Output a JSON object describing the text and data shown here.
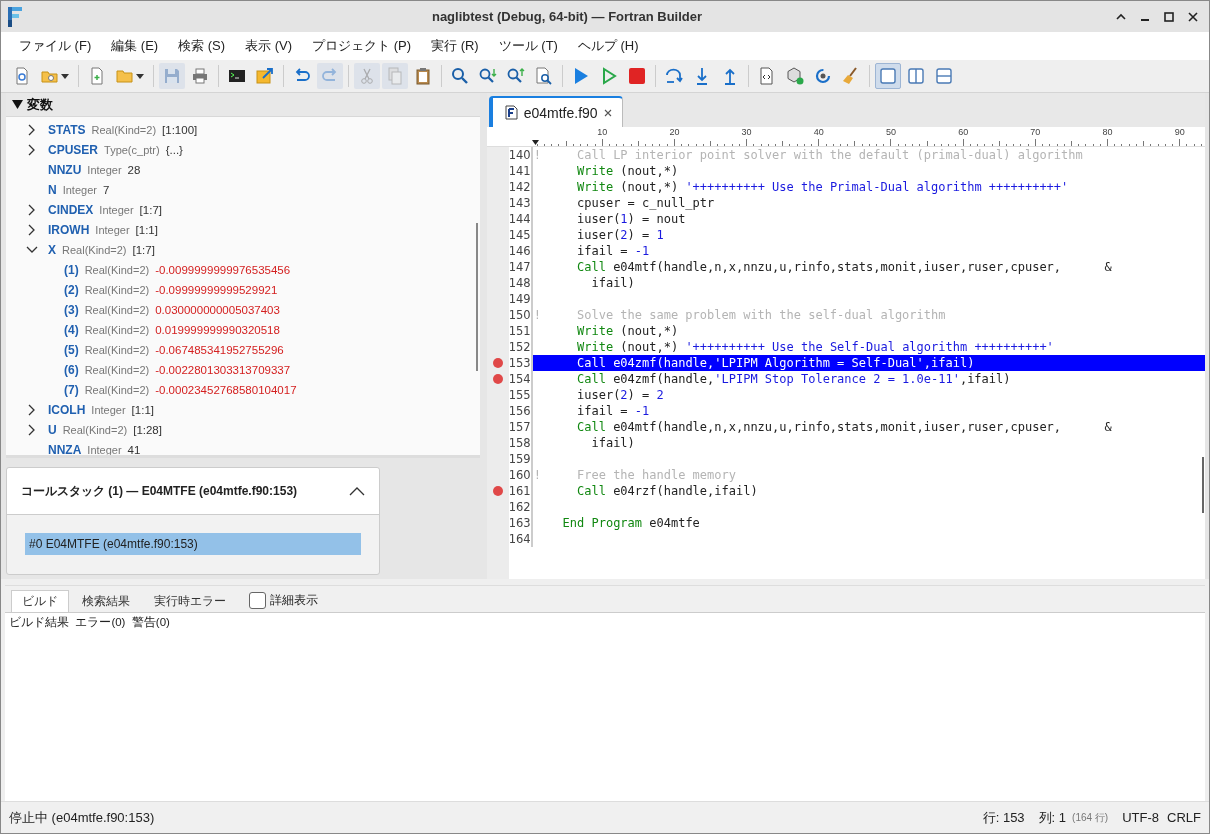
{
  "window": {
    "title": "naglibtest (Debug, 64-bit) — Fortran Builder"
  },
  "menu": [
    "ファイル (F)",
    "編集 (E)",
    "検索 (S)",
    "表示 (V)",
    "プロジェクト (P)",
    "実行 (R)",
    "ツール (T)",
    "ヘルプ (H)"
  ],
  "toolbar": [
    [
      {
        "kind": "project-settings",
        "disabled": false
      },
      {
        "kind": "open-project",
        "disabled": false,
        "dropdown": true
      }
    ],
    [
      {
        "kind": "new-file",
        "disabled": false
      },
      {
        "kind": "open-file",
        "disabled": false,
        "dropdown": true
      }
    ],
    [
      {
        "kind": "save",
        "disabled": true
      },
      {
        "kind": "print",
        "disabled": false
      }
    ],
    [
      {
        "kind": "terminal",
        "disabled": false
      },
      {
        "kind": "export",
        "disabled": false
      }
    ],
    [
      {
        "kind": "undo",
        "disabled": false
      },
      {
        "kind": "redo",
        "disabled": true
      }
    ],
    [
      {
        "kind": "cut",
        "disabled": true
      },
      {
        "kind": "copy",
        "disabled": true
      },
      {
        "kind": "paste",
        "disabled": false
      }
    ],
    [
      {
        "kind": "find",
        "disabled": false
      },
      {
        "kind": "find-next",
        "disabled": false
      },
      {
        "kind": "find-previous",
        "disabled": false
      },
      {
        "kind": "find-in-files",
        "disabled": false
      }
    ],
    [
      {
        "kind": "run",
        "disabled": false
      },
      {
        "kind": "run-without-debug",
        "disabled": false
      },
      {
        "kind": "stop",
        "disabled": false
      }
    ],
    [
      {
        "kind": "step-over",
        "disabled": false
      },
      {
        "kind": "step-into",
        "disabled": false
      },
      {
        "kind": "step-out",
        "disabled": false
      }
    ],
    [
      {
        "kind": "source-view",
        "disabled": false
      },
      {
        "kind": "add-module",
        "disabled": false
      },
      {
        "kind": "rebuild",
        "disabled": false
      },
      {
        "kind": "clean",
        "disabled": false
      }
    ],
    [
      {
        "kind": "layout-single",
        "disabled": false,
        "selected": true
      },
      {
        "kind": "layout-columns",
        "disabled": false,
        "selected": false
      },
      {
        "kind": "layout-rows",
        "disabled": false,
        "selected": false
      }
    ]
  ],
  "variables": {
    "title": "変数",
    "expanded": true,
    "items": [
      {
        "name": "STATS",
        "type": "Real(Kind=2)",
        "value": "[1:100]",
        "expanded": false,
        "changed": false
      },
      {
        "name": "CPUSER",
        "type": "Type(c_ptr)",
        "value": "{...}",
        "expanded": false,
        "changed": false
      },
      {
        "name": "NNZU",
        "type": "Integer",
        "value": "28",
        "changed": false
      },
      {
        "name": "N",
        "type": "Integer",
        "value": "7",
        "changed": false
      },
      {
        "name": "CINDEX",
        "type": "Integer",
        "value": "[1:7]",
        "expanded": false,
        "changed": false
      },
      {
        "name": "IROWH",
        "type": "Integer",
        "value": "[1:1]",
        "expanded": false,
        "changed": false
      },
      {
        "name": "X",
        "type": "Real(Kind=2)",
        "value": "[1:7]",
        "expanded": true,
        "changed": false,
        "children": [
          {
            "name": "(1)",
            "type": "Real(Kind=2)",
            "value": "-0.0099999999976535456",
            "changed": true
          },
          {
            "name": "(2)",
            "type": "Real(Kind=2)",
            "value": "-0.09999999999529921",
            "changed": true
          },
          {
            "name": "(3)",
            "type": "Real(Kind=2)",
            "value": "0.030000000005037403",
            "changed": true
          },
          {
            "name": "(4)",
            "type": "Real(Kind=2)",
            "value": "0.019999999990320518",
            "changed": true
          },
          {
            "name": "(5)",
            "type": "Real(Kind=2)",
            "value": "-0.067485341952755296",
            "changed": true
          },
          {
            "name": "(6)",
            "type": "Real(Kind=2)",
            "value": "-0.0022801303313709337",
            "changed": true
          },
          {
            "name": "(7)",
            "type": "Real(Kind=2)",
            "value": "-0.00023452768580104017",
            "changed": true
          }
        ]
      },
      {
        "name": "ICOLH",
        "type": "Integer",
        "value": "[1:1]",
        "expanded": false,
        "changed": false
      },
      {
        "name": "U",
        "type": "Real(Kind=2)",
        "value": "[1:28]",
        "expanded": false,
        "changed": false
      },
      {
        "name": "NNZA",
        "type": "Integer",
        "value": "41",
        "changed": false
      }
    ]
  },
  "call_stack": {
    "title": "コールスタック (1) — E04MTFE (e04mtfe.f90:153)",
    "expanded": true,
    "frames": [
      {
        "text": "#0  E04MTFE  (e04mtfe.f90:153)",
        "selected": true
      }
    ]
  },
  "editor": {
    "tabs": [
      {
        "label": "e04mtfe.f90",
        "selected": true
      }
    ],
    "ruler": [
      "10",
      "20",
      "30",
      "40",
      "50",
      "60",
      "70",
      "80",
      "90"
    ],
    "lines": [
      {
        "number": "140",
        "breakpoint": false,
        "current": false,
        "segments": [
          {
            "kind": "comment",
            "text": "!     Call LP interior point solver with the default (primal-dual) algorithm"
          }
        ]
      },
      {
        "number": "141",
        "breakpoint": false,
        "current": false,
        "segments": [
          {
            "kind": "keyword",
            "text": "      Write"
          },
          {
            "kind": "plain",
            "text": " (nout,*)"
          }
        ]
      },
      {
        "number": "142",
        "breakpoint": false,
        "current": false,
        "segments": [
          {
            "kind": "keyword",
            "text": "      Write"
          },
          {
            "kind": "plain",
            "text": " (nout,*) "
          },
          {
            "kind": "string",
            "text": "'++++++++++ Use the Primal-Dual algorithm ++++++++++'"
          }
        ]
      },
      {
        "number": "143",
        "breakpoint": false,
        "current": false,
        "segments": [
          {
            "kind": "plain",
            "text": "      cpuser = c_null_ptr"
          }
        ]
      },
      {
        "number": "144",
        "breakpoint": false,
        "current": false,
        "segments": [
          {
            "kind": "plain",
            "text": "      iuser("
          },
          {
            "kind": "number",
            "text": "1"
          },
          {
            "kind": "plain",
            "text": ") = nout"
          }
        ]
      },
      {
        "number": "145",
        "breakpoint": false,
        "current": false,
        "segments": [
          {
            "kind": "plain",
            "text": "      iuser("
          },
          {
            "kind": "number",
            "text": "2"
          },
          {
            "kind": "plain",
            "text": ") = "
          },
          {
            "kind": "number",
            "text": "1"
          }
        ]
      },
      {
        "number": "146",
        "breakpoint": false,
        "current": false,
        "segments": [
          {
            "kind": "plain",
            "text": "      ifail = "
          },
          {
            "kind": "number",
            "text": "-1"
          }
        ]
      },
      {
        "number": "147",
        "breakpoint": false,
        "current": false,
        "segments": [
          {
            "kind": "keyword",
            "text": "      Call"
          },
          {
            "kind": "plain",
            "text": " e04mtf(handle,n,x,nnzu,u,rinfo,stats,monit,iuser,ruser,cpuser,      &"
          }
        ]
      },
      {
        "number": "148",
        "breakpoint": false,
        "current": false,
        "segments": [
          {
            "kind": "plain",
            "text": "        ifail)"
          }
        ]
      },
      {
        "number": "149",
        "breakpoint": false,
        "current": false
      },
      {
        "number": "150",
        "breakpoint": false,
        "current": false,
        "segments": [
          {
            "kind": "comment",
            "text": "!     Solve the same problem with the self-dual algorithm"
          }
        ]
      },
      {
        "number": "151",
        "breakpoint": false,
        "current": false,
        "segments": [
          {
            "kind": "keyword",
            "text": "      Write"
          },
          {
            "kind": "plain",
            "text": " (nout,*)"
          }
        ]
      },
      {
        "number": "152",
        "breakpoint": false,
        "current": false,
        "segments": [
          {
            "kind": "keyword",
            "text": "      Write"
          },
          {
            "kind": "plain",
            "text": " (nout,*) "
          },
          {
            "kind": "string",
            "text": "'++++++++++ Use the Self-Dual algorithm ++++++++++'"
          }
        ]
      },
      {
        "number": "153",
        "breakpoint": true,
        "current": true,
        "segments": [
          {
            "kind": "keyword",
            "text": "      Call"
          },
          {
            "kind": "plain",
            "text": " e04zmf(handle,"
          },
          {
            "kind": "string",
            "text": "'LPIPM Algorithm = Self-Dual'"
          },
          {
            "kind": "plain",
            "text": ",ifail)"
          }
        ]
      },
      {
        "number": "154",
        "breakpoint": true,
        "current": false,
        "segments": [
          {
            "kind": "keyword",
            "text": "      Call"
          },
          {
            "kind": "plain",
            "text": " e04zmf(handle,"
          },
          {
            "kind": "string",
            "text": "'LPIPM Stop Tolerance 2 = 1.0e-11'"
          },
          {
            "kind": "plain",
            "text": ",ifail)"
          }
        ]
      },
      {
        "number": "155",
        "breakpoint": false,
        "current": false,
        "segments": [
          {
            "kind": "plain",
            "text": "      iuser("
          },
          {
            "kind": "number",
            "text": "2"
          },
          {
            "kind": "plain",
            "text": ") = "
          },
          {
            "kind": "number",
            "text": "2"
          }
        ]
      },
      {
        "number": "156",
        "breakpoint": false,
        "current": false,
        "segments": [
          {
            "kind": "plain",
            "text": "      ifail = "
          },
          {
            "kind": "number",
            "text": "-1"
          }
        ]
      },
      {
        "number": "157",
        "breakpoint": false,
        "current": false,
        "segments": [
          {
            "kind": "keyword",
            "text": "      Call"
          },
          {
            "kind": "plain",
            "text": " e04mtf(handle,n,x,nnzu,u,rinfo,stats,monit,iuser,ruser,cpuser,      &"
          }
        ]
      },
      {
        "number": "158",
        "breakpoint": false,
        "current": false,
        "segments": [
          {
            "kind": "plain",
            "text": "        ifail)"
          }
        ]
      },
      {
        "number": "159",
        "breakpoint": false,
        "current": false
      },
      {
        "number": "160",
        "breakpoint": false,
        "current": false,
        "segments": [
          {
            "kind": "comment",
            "text": "!     Free the handle memory"
          }
        ]
      },
      {
        "number": "161",
        "breakpoint": true,
        "current": false,
        "segments": [
          {
            "kind": "keyword",
            "text": "      Call"
          },
          {
            "kind": "plain",
            "text": " e04rzf(handle,ifail)"
          }
        ]
      },
      {
        "number": "162",
        "breakpoint": false,
        "current": false
      },
      {
        "number": "163",
        "breakpoint": false,
        "current": false,
        "segments": [
          {
            "kind": "keyword",
            "text": "    End Program"
          },
          {
            "kind": "plain",
            "text": " e04mtfe"
          }
        ]
      },
      {
        "number": "164",
        "breakpoint": false,
        "current": false
      }
    ]
  },
  "output": {
    "tabs": [
      {
        "label": "ビルド",
        "selected": true
      },
      {
        "label": "検索結果",
        "selected": false
      },
      {
        "label": "実行時エラー",
        "selected": false
      }
    ],
    "verbose": {
      "label": "詳細表示",
      "checked": false
    },
    "text": "ビルド結果  エラー(0)  警告(0)"
  },
  "status_bar": {
    "state": "停止中 (e04mtfe.f90:153)",
    "line": "行: 153",
    "column": "列: 1",
    "total": "(164 行)",
    "encoding": "UTF-8",
    "line_ending": "CRLF"
  }
}
